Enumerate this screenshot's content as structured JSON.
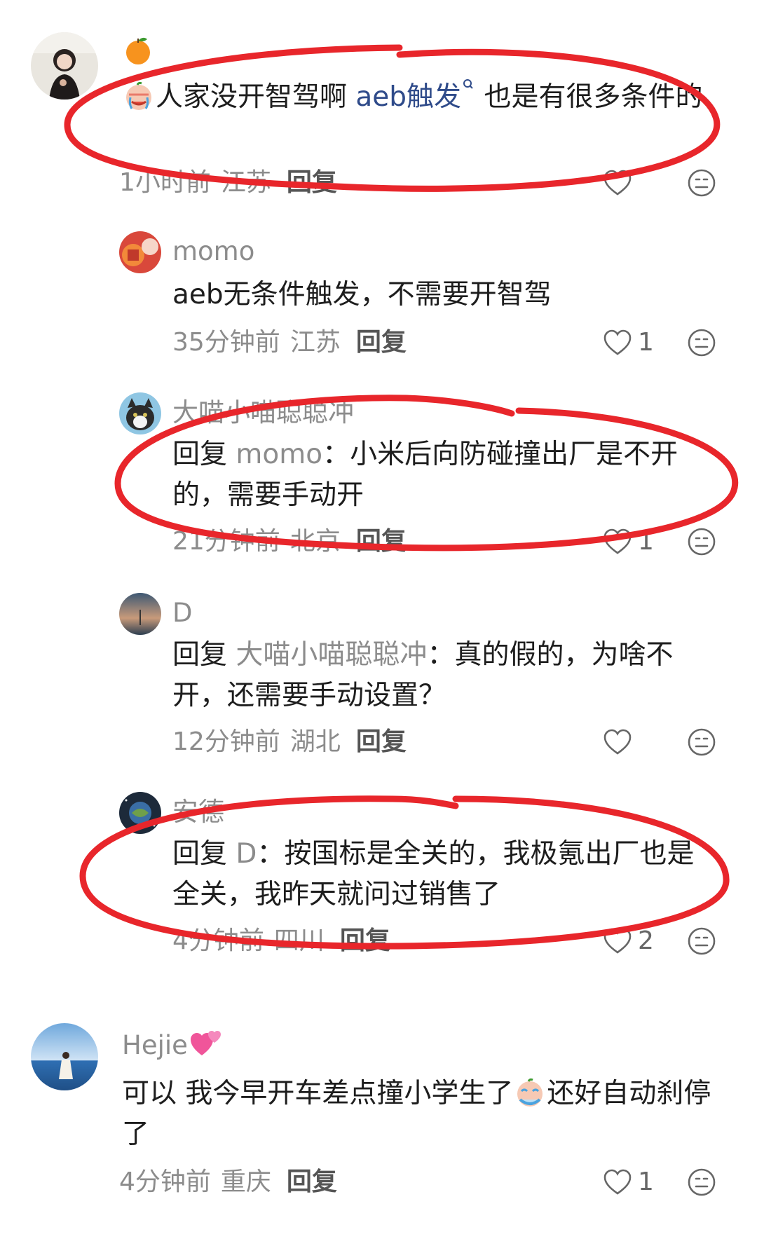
{
  "comments": [
    {
      "user": "",
      "text_before": "人家没开智驾啊 ",
      "link": "aeb触发",
      "text_after": " 也是有很多条件的",
      "time": "1小时前",
      "location": "江苏",
      "reply_label": "回复",
      "likes": ""
    }
  ],
  "replies": [
    {
      "user": "momo",
      "text": "aeb无条件触发，不需要开智驾",
      "time": "35分钟前",
      "location": "江苏",
      "reply_label": "回复",
      "likes": "1"
    },
    {
      "user": "大喵小喵聪聪冲",
      "reply_prefix": "回复",
      "reply_target": "momo",
      "text": "：小米后向防碰撞出厂是不开的，需要手动开",
      "time": "21分钟前",
      "location": "北京",
      "reply_label": "回复",
      "likes": "1"
    },
    {
      "user": "D",
      "reply_prefix": "回复",
      "reply_target": "大喵小喵聪聪冲",
      "text": "：真的假的，为啥不开，还需要手动设置？",
      "time": "12分钟前",
      "location": "湖北",
      "reply_label": "回复",
      "likes": ""
    },
    {
      "user": "安德",
      "reply_prefix": "回复",
      "reply_target": "D",
      "text": "：按国标是全关的，我极氪出厂也是全关，我昨天就问过销售了",
      "time": "4分钟前",
      "location": "四川",
      "reply_label": "回复",
      "likes": "2"
    }
  ],
  "bottom_comment": {
    "user": "Hejie",
    "text_before": "可以 我今早开车差点撞小学生了",
    "text_after": "还好自动刹停了",
    "time": "4分钟前",
    "location": "重庆",
    "reply_label": "回复",
    "likes": "1"
  },
  "colors": {
    "link": "#2f4b8a",
    "meta": "#8c8c8c",
    "annotation": "#e8262b"
  },
  "icons": [
    "orange-emoji-icon",
    "crying-emoji-icon",
    "heart-icon",
    "emoji-reaction-icon",
    "hearts-emoji-icon",
    "search-link-icon"
  ]
}
